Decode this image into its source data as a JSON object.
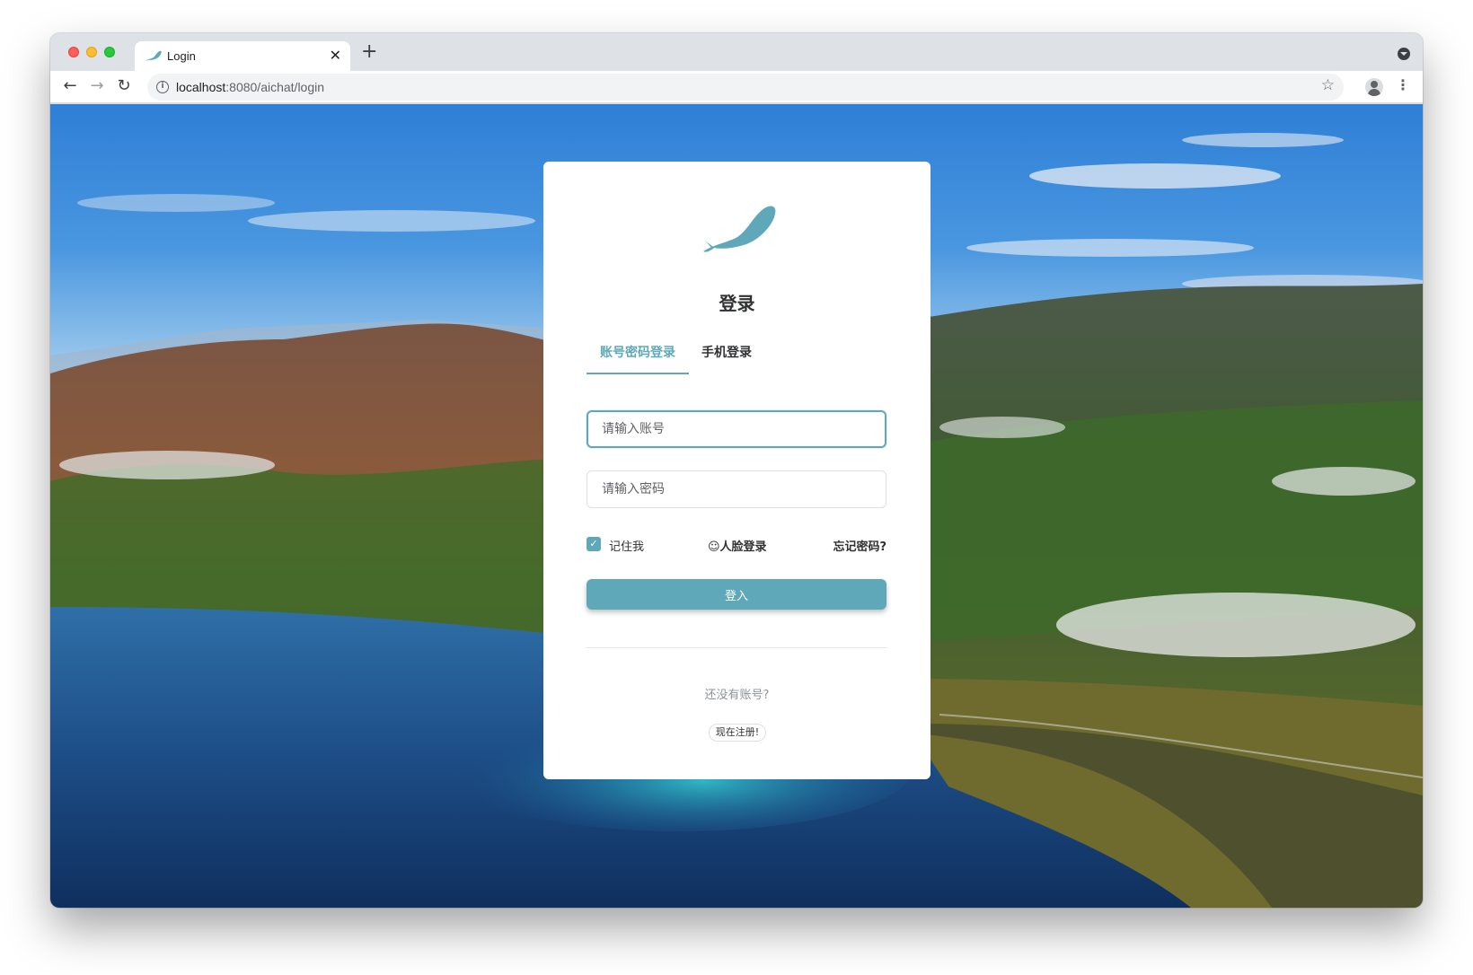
{
  "browser": {
    "tab_title": "Login",
    "url_host": "localhost",
    "url_rest": ":8080/aichat/login"
  },
  "login": {
    "heading": "登录",
    "tabs": [
      {
        "label": "账号密码登录",
        "active": true
      },
      {
        "label": "手机登录",
        "active": false
      }
    ],
    "username_placeholder": "请输入账号",
    "password_placeholder": "请输入密码",
    "remember_label": "记住我",
    "remember_checked": true,
    "face_login_label": "☺人脸登录",
    "forgot_label": "忘记密码?",
    "submit_label": "登入",
    "no_account_text": "还没有账号?",
    "register_label": "现在注册!"
  },
  "colors": {
    "accent": "#5fa8b9",
    "text": "#303133"
  },
  "icons": {
    "tab_favicon": "whale-icon",
    "logo": "whale-icon",
    "back": "arrow-left-icon",
    "forward": "arrow-right-icon",
    "reload": "reload-icon",
    "site_info": "info-icon",
    "bookmark": "star-icon",
    "profile": "profile-icon",
    "menu": "kebab-menu-icon"
  }
}
